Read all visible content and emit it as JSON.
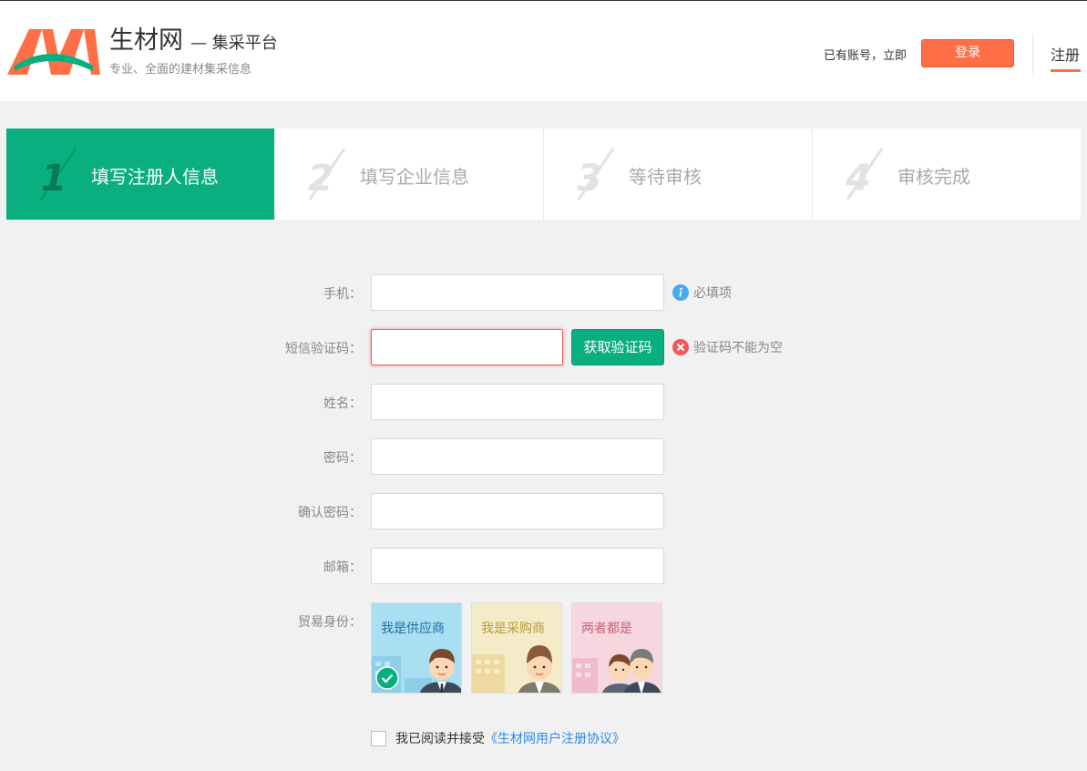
{
  "header": {
    "brand_name": "生材网",
    "brand_suffix": "— 集采平台",
    "slogan": "专业、全面的建材集采信息",
    "have_account_text": "已有账号，立即",
    "login_label": "登录",
    "register_label": "注册",
    "accent_color": "#fe6e47"
  },
  "steps": [
    {
      "number": "1",
      "label": "填写注册人信息",
      "active": true
    },
    {
      "number": "2",
      "label": "填写企业信息",
      "active": false
    },
    {
      "number": "3",
      "label": "等待审核",
      "active": false
    },
    {
      "number": "4",
      "label": "审核完成",
      "active": false
    }
  ],
  "form": {
    "phone": {
      "label": "手机：",
      "value": "",
      "hint": "必填项",
      "hint_icon": "info-icon"
    },
    "sms_code": {
      "label": "短信验证码：",
      "value": "",
      "button_label": "获取验证码",
      "error": "验证码不能为空",
      "error_icon": "error-icon"
    },
    "name": {
      "label": "姓名：",
      "value": ""
    },
    "password": {
      "label": "密码：",
      "value": ""
    },
    "confirm_password": {
      "label": "确认密码：",
      "value": ""
    },
    "email": {
      "label": "邮箱：",
      "value": ""
    },
    "trade_role": {
      "label": "贸易身份：",
      "options": [
        {
          "label": "我是供应商",
          "selected": true
        },
        {
          "label": "我是采购商",
          "selected": false
        },
        {
          "label": "两者都是",
          "selected": false
        }
      ]
    },
    "agreement": {
      "text": "我已阅读并接受",
      "link": "《生材网用户注册协议》",
      "checked": false
    }
  },
  "colors": {
    "primary_green": "#0aaf7f",
    "accent_orange": "#fe6e47",
    "error_red": "#f05a5a",
    "info_blue": "#4aa8f0"
  }
}
